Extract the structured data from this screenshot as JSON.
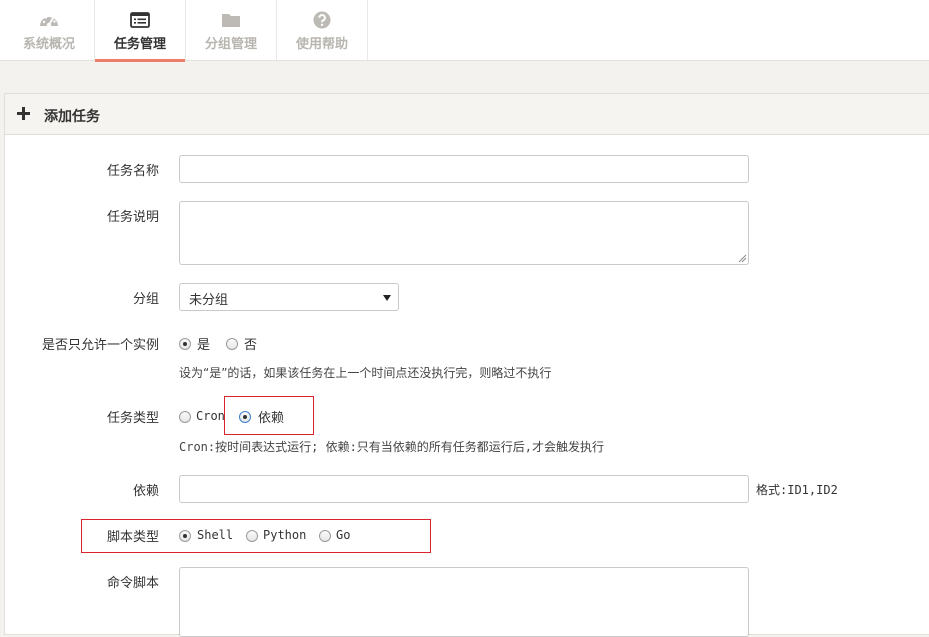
{
  "nav": {
    "tabs": [
      {
        "label": "系统概况",
        "icon": "dashboard-icon"
      },
      {
        "label": "任务管理",
        "icon": "task-list-icon",
        "active": true
      },
      {
        "label": "分组管理",
        "icon": "folder-icon"
      },
      {
        "label": "使用帮助",
        "icon": "help-icon"
      }
    ]
  },
  "panel": {
    "title": "添加任务",
    "icon": "plus-icon"
  },
  "form": {
    "name": {
      "label": "任务名称",
      "value": "",
      "placeholder": ""
    },
    "description": {
      "label": "任务说明",
      "value": ""
    },
    "group": {
      "label": "分组",
      "selected": "未分组"
    },
    "single_instance": {
      "label": "是否只允许一个实例",
      "options": [
        "是",
        "否"
      ],
      "selected": "是",
      "help": "设为“是”的话，如果该任务在上一个时间点还没执行完，则略过不执行"
    },
    "task_type": {
      "label": "任务类型",
      "options": [
        "Cron",
        "依赖"
      ],
      "selected": "依赖",
      "help": "Cron:按时间表达式运行; 依赖:只有当依赖的所有任务都运行后,才会触发执行"
    },
    "dependency": {
      "label": "依赖",
      "value": "",
      "hint": "格式:ID1,ID2"
    },
    "script_type": {
      "label": "脚本类型",
      "options": [
        "Shell",
        "Python",
        "Go"
      ],
      "selected": "Shell"
    },
    "command": {
      "label": "命令脚本",
      "value": ""
    }
  },
  "colors": {
    "accent": "#ef7d6b",
    "highlight": "#d9232d",
    "panel_header": "#f6f4f0",
    "page_bg": "#f4f2ef"
  }
}
